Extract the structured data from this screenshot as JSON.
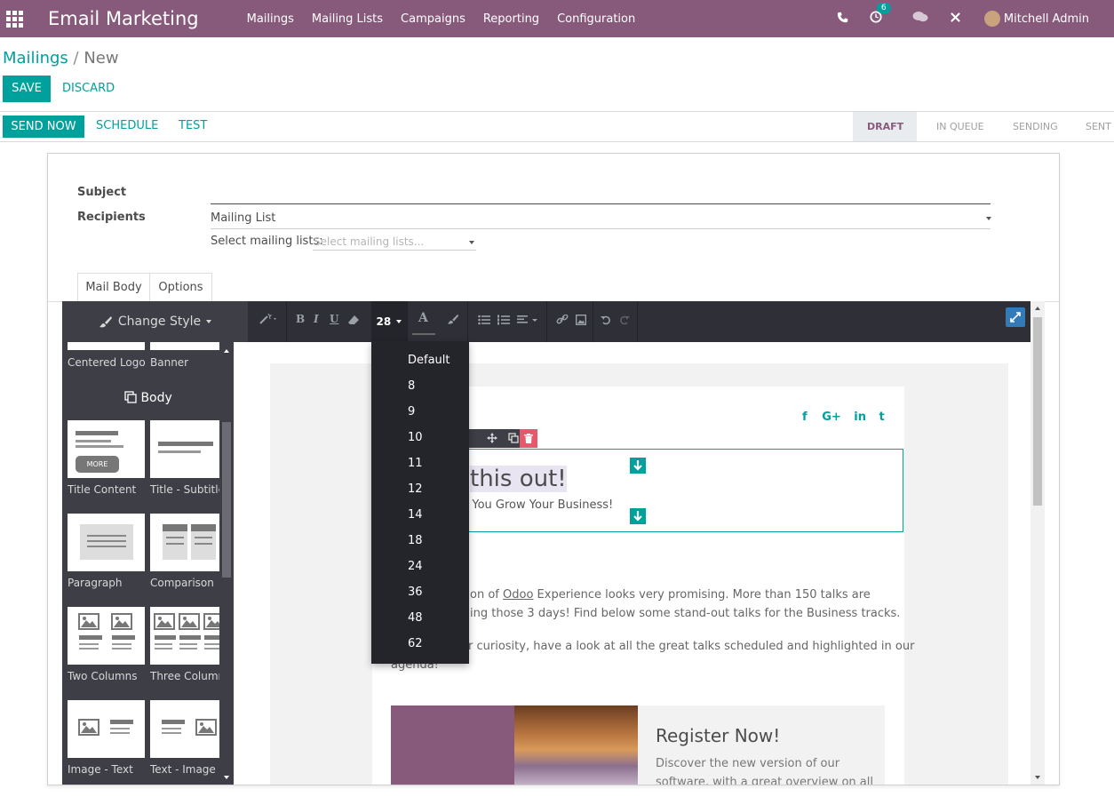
{
  "navbar": {
    "app_title": "Email Marketing",
    "menu": [
      "Mailings",
      "Mailing Lists",
      "Campaigns",
      "Reporting",
      "Configuration"
    ],
    "activity_count": "6",
    "user": "Mitchell Admin"
  },
  "breadcrumb": {
    "parent": "Mailings",
    "separator": "/",
    "current": "New"
  },
  "actions": {
    "save": "SAVE",
    "discard": "DISCARD",
    "send_now": "SEND NOW",
    "schedule": "SCHEDULE",
    "test": "TEST"
  },
  "status_steps": [
    "DRAFT",
    "IN QUEUE",
    "SENDING",
    "SENT"
  ],
  "form": {
    "subject_label": "Subject",
    "subject_value": "",
    "recipients_label": "Recipients",
    "recipients_value": "Mailing List",
    "select_lists_label": "Select mailing lists:",
    "select_lists_placeholder": "Select mailing lists..."
  },
  "tabs": [
    "Mail Body",
    "Options"
  ],
  "editor": {
    "change_style": "Change Style",
    "font_size": "28",
    "font_size_options": [
      "Default",
      "8",
      "9",
      "10",
      "11",
      "12",
      "14",
      "18",
      "24",
      "36",
      "48",
      "62"
    ]
  },
  "snippets": {
    "header_items": [
      "Centered Logo",
      "Banner"
    ],
    "body_title": "Body",
    "body_items": [
      "Title Content",
      "Title - Subtitle",
      "Paragraph",
      "Comparison",
      "Two Columns",
      "Three Columns",
      "Image - Text",
      "Text - Image"
    ],
    "more_label": "MORE"
  },
  "mail": {
    "title_fragment": "this out!",
    "subtitle_fragment": "p You Grow Your Business!",
    "para1_line1_pre": "on of ",
    "para1_link": "Odoo",
    "para1_line1_post": " Experience looks very promising. More than 150 talks are",
    "para1_line2": "ing those 3 days! Find below some stand-out talks for the Business tracks.",
    "para2_line1": "r curiosity, have a look at all the great talks scheduled and highlighted in our",
    "para2_line2": "agenda!",
    "register_title": "Register Now!",
    "register_line1": "Discover the new version of our",
    "register_line2": "software, with a great overview on all",
    "social": [
      "f",
      "G+",
      "in",
      "t"
    ],
    "brand_color": "#875a7b",
    "accent_color": "#00a09d"
  }
}
